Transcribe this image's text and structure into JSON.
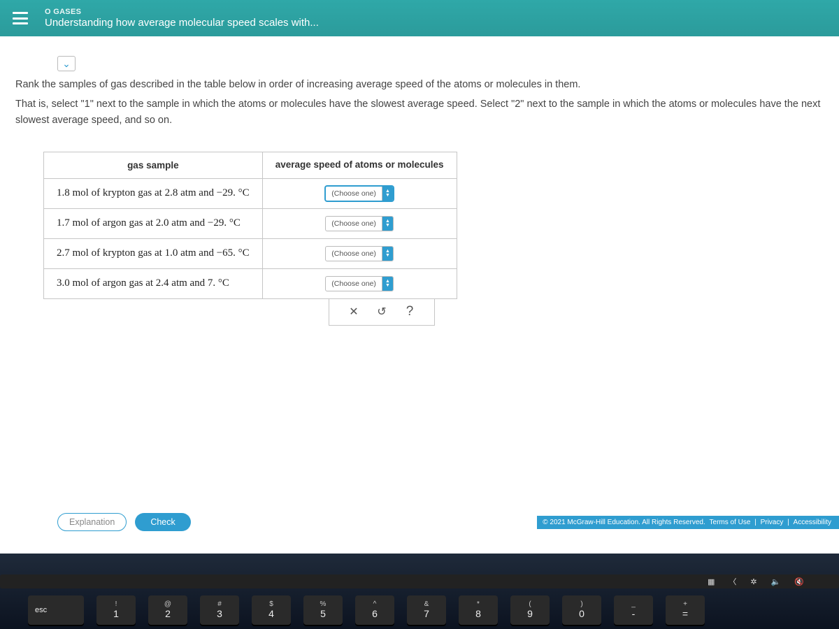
{
  "header": {
    "topic": "O GASES",
    "title": "Understanding how average molecular speed scales with..."
  },
  "instructions": {
    "line1": "Rank the samples of gas described in the table below in order of increasing average speed of the atoms or molecules in them.",
    "line2": "That is, select \"1\" next to the sample in which the atoms or molecules have the slowest average speed. Select \"2\" next to the sample in which the atoms or molecules have the next slowest average speed, and so on."
  },
  "table": {
    "col1_header": "gas sample",
    "col2_header": "average speed of atoms or molecules",
    "rows": [
      {
        "sample": "1.8 mol of krypton gas at 2.8 atm and −29. °C",
        "select": "(Choose one)"
      },
      {
        "sample": "1.7 mol of argon gas at 2.0 atm and −29. °C",
        "select": "(Choose one)"
      },
      {
        "sample": "2.7 mol of krypton gas at 1.0 atm and −65. °C",
        "select": "(Choose one)"
      },
      {
        "sample": "3.0 mol of argon gas at 2.4 atm and 7. °C",
        "select": "(Choose one)"
      }
    ]
  },
  "tools": {
    "clear": "✕",
    "reset": "↺",
    "help": "?"
  },
  "footer": {
    "explanation_label": "Explanation",
    "check_label": "Check",
    "copyright": "© 2021 McGraw-Hill Education. All Rights Reserved.",
    "links": {
      "terms": "Terms of Use",
      "privacy": "Privacy",
      "accessibility": "Accessibility"
    }
  },
  "keyboard": {
    "esc": "esc",
    "keys": [
      {
        "upper": "!",
        "lower": "1"
      },
      {
        "upper": "@",
        "lower": "2"
      },
      {
        "upper": "#",
        "lower": "3"
      },
      {
        "upper": "$",
        "lower": "4"
      },
      {
        "upper": "%",
        "lower": "5"
      },
      {
        "upper": "^",
        "lower": "6"
      },
      {
        "upper": "&",
        "lower": "7"
      },
      {
        "upper": "*",
        "lower": "8"
      },
      {
        "upper": "(",
        "lower": "9"
      },
      {
        "upper": ")",
        "lower": "0"
      },
      {
        "upper": "_",
        "lower": "-"
      },
      {
        "upper": "+",
        "lower": "="
      }
    ]
  }
}
